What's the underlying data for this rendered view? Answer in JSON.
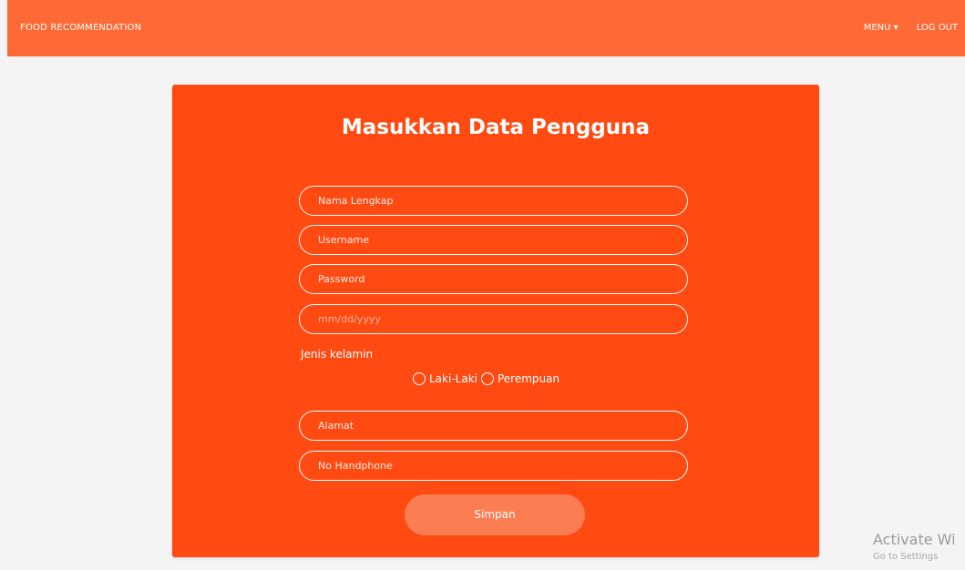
{
  "navbar": {
    "brand": "FOOD RECOMMENDATION",
    "menu": "MENU ▾",
    "logout": "LOG OUT"
  },
  "form": {
    "title": "Masukkan Data Pengguna",
    "fields": {
      "nama": "Nama Lengkap",
      "username": "Username",
      "password": "Password",
      "tanggal": "mm/dd/yyyy",
      "alamat": "Alamat",
      "handphone": "No Handphone"
    },
    "gender_label": "Jenis kelamin",
    "gender_options": [
      "Laki-Laki",
      "Perempuan"
    ],
    "submit": "Simpan"
  },
  "watermark": {
    "line1": "Activate Wi",
    "line2": "Go to Settings"
  },
  "colors": {
    "navbar": "#fd6a35",
    "card": "#ff4a12",
    "button": "#fb7d52"
  }
}
